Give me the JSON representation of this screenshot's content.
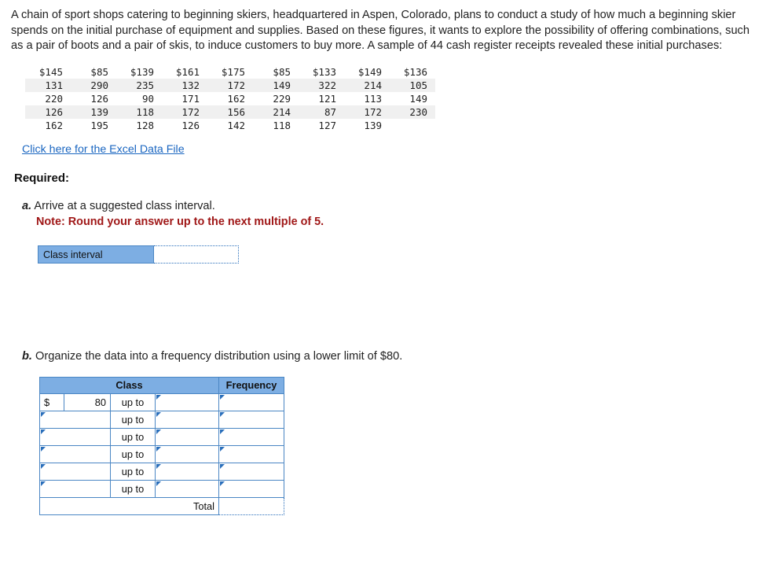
{
  "intro": "A chain of sport shops catering to beginning skiers, headquartered in Aspen, Colorado, plans to conduct a study of how much a beginning skier spends on the initial purchase of equipment and supplies. Based on these figures, it wants to explore the possibility of offering combinations, such as a pair of boots and a pair of skis, to induce customers to buy more. A sample of 44 cash register receipts revealed these initial purchases:",
  "data_rows": [
    [
      "$145",
      "$85",
      "$139",
      "$161",
      "$175",
      "$85",
      "$133",
      "$149",
      "$136"
    ],
    [
      "131",
      "290",
      "235",
      "132",
      "172",
      "149",
      "322",
      "214",
      "105"
    ],
    [
      "220",
      "126",
      "90",
      "171",
      "162",
      "229",
      "121",
      "113",
      "149"
    ],
    [
      "126",
      "139",
      "118",
      "172",
      "156",
      "214",
      "87",
      "172",
      "230"
    ],
    [
      "162",
      "195",
      "128",
      "126",
      "142",
      "118",
      "127",
      "139",
      ""
    ]
  ],
  "excel_link": "Click here for the Excel Data File",
  "required_label": "Required:",
  "part_a": {
    "letter": "a.",
    "text": "Arrive at a suggested class interval.",
    "note": "Note: Round your answer up to the next multiple of 5.",
    "answer_label": "Class interval",
    "answer_value": ""
  },
  "part_b": {
    "letter": "b.",
    "text": "Organize the data into a frequency distribution using a lower limit of $80.",
    "headers": {
      "class": "Class",
      "frequency": "Frequency"
    },
    "rows": [
      {
        "dollar": "$",
        "lower": "80",
        "upto": "up to",
        "upper": "",
        "frequency": ""
      },
      {
        "dollar": "",
        "lower": "",
        "upto": "up to",
        "upper": "",
        "frequency": ""
      },
      {
        "dollar": "",
        "lower": "",
        "upto": "up to",
        "upper": "",
        "frequency": ""
      },
      {
        "dollar": "",
        "lower": "",
        "upto": "up to",
        "upper": "",
        "frequency": ""
      },
      {
        "dollar": "",
        "lower": "",
        "upto": "up to",
        "upper": "",
        "frequency": ""
      },
      {
        "dollar": "",
        "lower": "",
        "upto": "up to",
        "upper": "",
        "frequency": ""
      }
    ],
    "total_label": "Total",
    "total_value": ""
  },
  "colors": {
    "header_blue": "#7daee3",
    "border_blue": "#4a86c4",
    "link_blue": "#1a66c1",
    "note_red": "#a01818"
  }
}
